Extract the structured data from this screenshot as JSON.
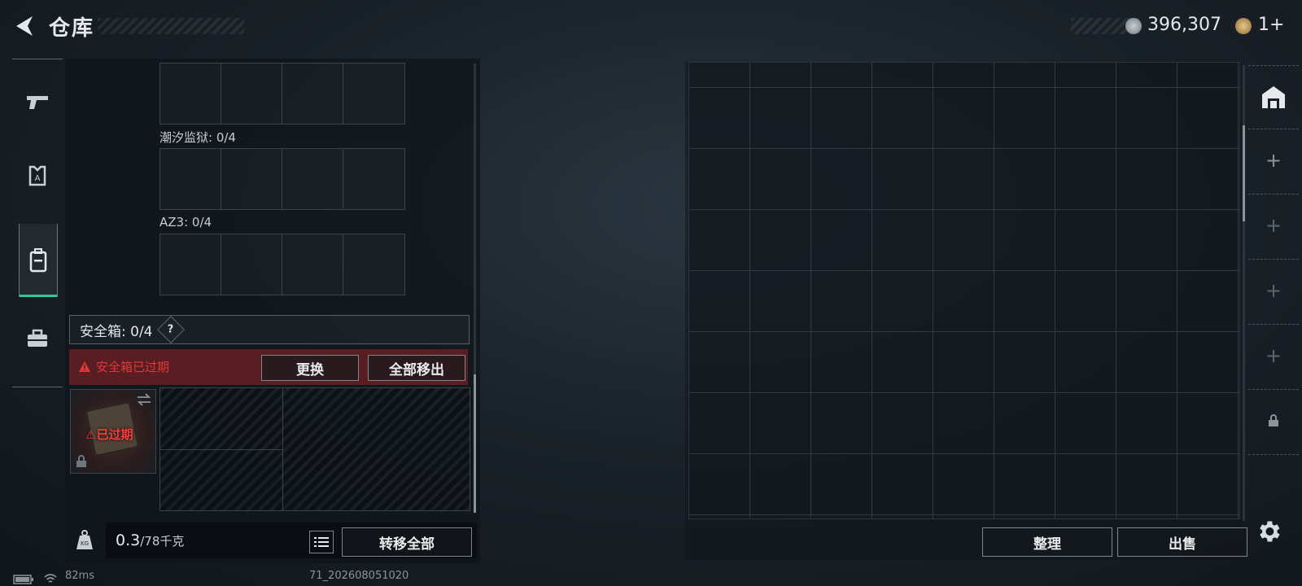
{
  "header": {
    "title": "仓库",
    "currency": "396,307",
    "level": "1+"
  },
  "left_panel": {
    "slots": [
      {
        "label": "潮汐监狱: 0/4"
      },
      {
        "label": "AZ3: 0/4"
      }
    ],
    "safe_box": {
      "title": "安全箱: 0/4",
      "help": "?",
      "expired_warning": "安全箱已过期",
      "replace_button": "更换",
      "remove_all_button": "全部移出",
      "item_status": "已过期"
    },
    "weight": {
      "current": "0.3",
      "max": "/78千克"
    },
    "transfer_all_button": "转移全部"
  },
  "right_panel": {
    "sort_button": "整理",
    "sell_button": "出售"
  },
  "status_bar": {
    "ping": "82ms",
    "build": "71_202608051020"
  },
  "colors": {
    "accent_green": "#35c79a",
    "warning_red": "#e0383c",
    "expired_bg": "#5a1e22"
  }
}
